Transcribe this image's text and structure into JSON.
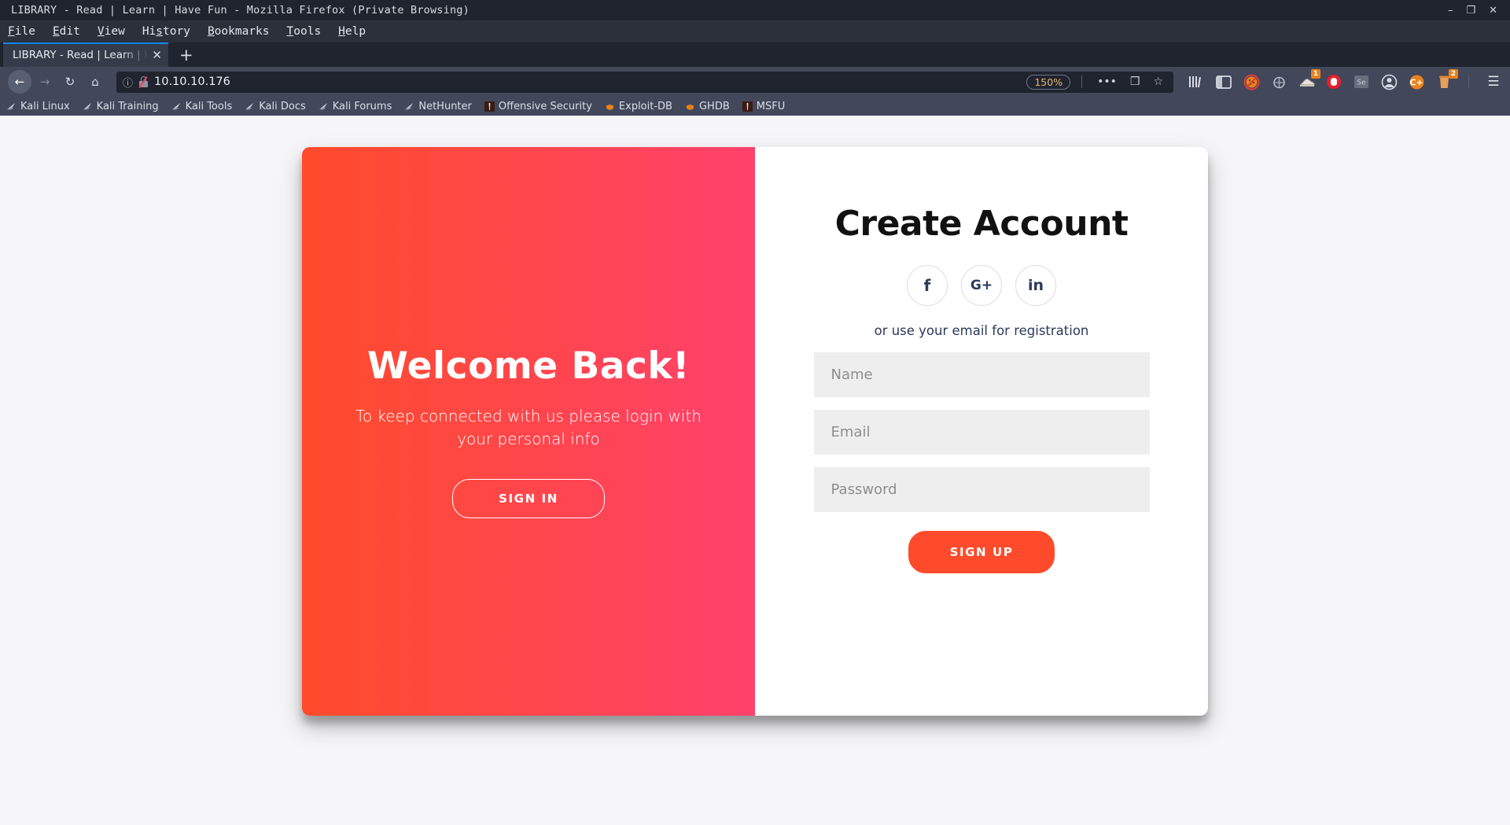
{
  "window": {
    "title": "LIBRARY - Read | Learn | Have Fun - Mozilla Firefox (Private Browsing)",
    "minimize": "–",
    "maximize": "❐",
    "close": "✕"
  },
  "menubar": [
    {
      "label": "File",
      "accel": "F"
    },
    {
      "label": "Edit",
      "accel": "E"
    },
    {
      "label": "View",
      "accel": "V"
    },
    {
      "label": "History",
      "accel": "s"
    },
    {
      "label": "Bookmarks",
      "accel": "B"
    },
    {
      "label": "Tools",
      "accel": "T"
    },
    {
      "label": "Help",
      "accel": "H"
    }
  ],
  "tab": {
    "title": "LIBRARY - Read | Learn | Have Fun",
    "close_label": "✕",
    "newtab_label": "+"
  },
  "toolbar": {
    "back_label": "←",
    "forward_label": "→",
    "reload_label": "↻",
    "home_label": "⌂",
    "url": "10.10.10.176",
    "info_icon": "ⓘ",
    "zoom_level": "150%",
    "more_label": "•••",
    "pocket_label": "❒",
    "bookmark_star": "☆",
    "menu_label": "☰",
    "extensions": [
      {
        "name": "library-icon",
        "glyph": "|||\\",
        "badge": ""
      },
      {
        "name": "sidebar-icon",
        "glyph": "▤",
        "badge": ""
      },
      {
        "name": "cookie-blocker-icon",
        "glyph": "⛔",
        "badge": ""
      },
      {
        "name": "wappalyzer-icon",
        "glyph": "◌",
        "badge": ""
      },
      {
        "name": "shoe-icon",
        "glyph": "👟",
        "badge": "1"
      },
      {
        "name": "stop-hand-icon",
        "glyph": "✋",
        "badge": ""
      },
      {
        "name": "selenium-icon",
        "glyph": "Se",
        "badge": ""
      },
      {
        "name": "account-icon",
        "glyph": "◎",
        "badge": ""
      },
      {
        "name": "cplus-icon",
        "glyph": "C+",
        "badge": ""
      },
      {
        "name": "trash-icon",
        "glyph": "🗑",
        "badge": "2"
      }
    ]
  },
  "bookmarks": [
    {
      "label": "Kali Linux",
      "icon": "kali-dragon-icon"
    },
    {
      "label": "Kali Training",
      "icon": "kali-dragon-icon"
    },
    {
      "label": "Kali Tools",
      "icon": "kali-dragon-icon"
    },
    {
      "label": "Kali Docs",
      "icon": "kali-dragon-icon"
    },
    {
      "label": "Kali Forums",
      "icon": "kali-dragon-icon"
    },
    {
      "label": "NetHunter",
      "icon": "kali-dragon-icon"
    },
    {
      "label": "Offensive Security",
      "icon": "offsec-icon"
    },
    {
      "label": "Exploit-DB",
      "icon": "exploitdb-icon"
    },
    {
      "label": "GHDB",
      "icon": "exploitdb-icon"
    },
    {
      "label": "MSFU",
      "icon": "offsec-icon"
    }
  ],
  "page": {
    "overlay": {
      "heading": "Welcome Back!",
      "paragraph": "To keep connected with us please login with your personal info",
      "signin_label": "SIGN IN"
    },
    "signup": {
      "heading": "Create Account",
      "socials": [
        {
          "name": "facebook-icon",
          "glyph": "f"
        },
        {
          "name": "google-plus-icon",
          "glyph": "G+"
        },
        {
          "name": "linkedin-icon",
          "glyph": "in"
        }
      ],
      "hint": "or use your email for registration",
      "fields": [
        {
          "name": "name-input",
          "placeholder": "Name",
          "value": ""
        },
        {
          "name": "email-input",
          "placeholder": "Email",
          "value": ""
        },
        {
          "name": "password-input",
          "placeholder": "Password",
          "value": ""
        }
      ],
      "submit_label": "SIGN UP"
    }
  },
  "colors": {
    "accent": "#ff4b2b",
    "accent_alt": "#ff416c",
    "page_bg": "#f6f5f7",
    "field_bg": "#eeeeee"
  }
}
